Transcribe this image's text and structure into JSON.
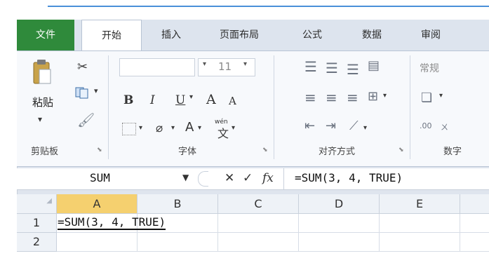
{
  "tabs": {
    "file": "文件",
    "home": "开始",
    "insert": "插入",
    "page_layout": "页面布局",
    "formulas": "公式",
    "data": "数据",
    "review": "审阅"
  },
  "ribbon": {
    "clipboard": {
      "paste_label": "粘贴",
      "group_label": "剪贴板"
    },
    "font": {
      "size_value": "11",
      "bold": "B",
      "italic": "I",
      "underline": "U",
      "grow": "A",
      "shrink": "A",
      "font_color": "A",
      "phonetic": "wén",
      "group_label": "字体"
    },
    "alignment": {
      "group_label": "对齐方式"
    },
    "number": {
      "format_value": "常规",
      "group_label": "数字",
      "increase_decimal": ".00",
      "decrease_decimal": "ㄨ"
    }
  },
  "formula_bar": {
    "name_box": "SUM",
    "cancel": "✕",
    "enter": "✓",
    "fx": "fx",
    "formula": "=SUM(3, 4, TRUE)"
  },
  "sheet": {
    "columns": [
      "A",
      "B",
      "C",
      "D",
      "E"
    ],
    "rows": [
      "1",
      "2"
    ],
    "cell_A1": "=SUM(3, 4, TRUE)"
  },
  "colors": {
    "file_tab": "#2f8a3b",
    "active_col_header": "#f5d06f",
    "accent_line": "#4a90d9"
  }
}
